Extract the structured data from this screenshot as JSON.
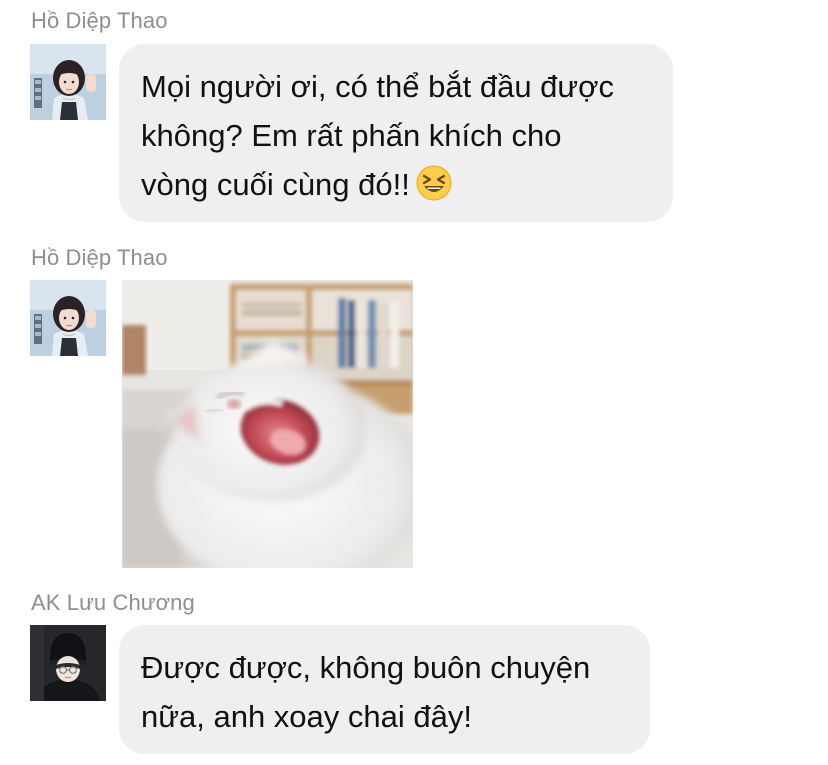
{
  "messages": [
    {
      "sender": "Hồ Diệp Thao",
      "avatar_icon": "user-avatar-girl-icon",
      "type": "text",
      "lines": [
        "Mọi người ơi, có thể bắt đầu được",
        "không? Em rất phấn khích cho",
        "vòng cuối cùng đó!!"
      ],
      "emoji": "laughing-squint-emoji"
    },
    {
      "sender": "Hồ Diệp Thao",
      "avatar_icon": "user-avatar-girl-icon",
      "type": "image",
      "image_icon": "yawning-white-cat-photo"
    },
    {
      "sender": "AK Lưu Chương",
      "avatar_icon": "user-avatar-beanie-icon",
      "type": "text",
      "lines": [
        "Được được, không buôn chuyện",
        "nữa, anh xoay chai đây!"
      ]
    }
  ],
  "colors": {
    "bubble_bg": "#efeff0",
    "sender_name": "#8e8e93",
    "message_text": "#111111"
  }
}
